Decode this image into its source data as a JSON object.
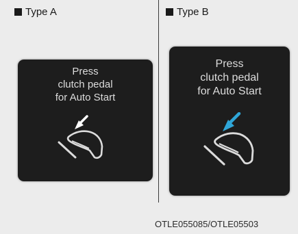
{
  "type_a": {
    "label": "Type A",
    "message": [
      "Press",
      "clutch pedal",
      "for Auto Start"
    ],
    "arrow_color": "#ffffff",
    "icon": "foot-pressing-pedal-icon"
  },
  "type_b": {
    "label": "Type B",
    "message": [
      "Press",
      "clutch pedal",
      "for Auto Start"
    ],
    "arrow_color": "#2fa6d8",
    "icon": "foot-pressing-pedal-icon"
  },
  "image_code": "OTLE055085/OTLE05503"
}
